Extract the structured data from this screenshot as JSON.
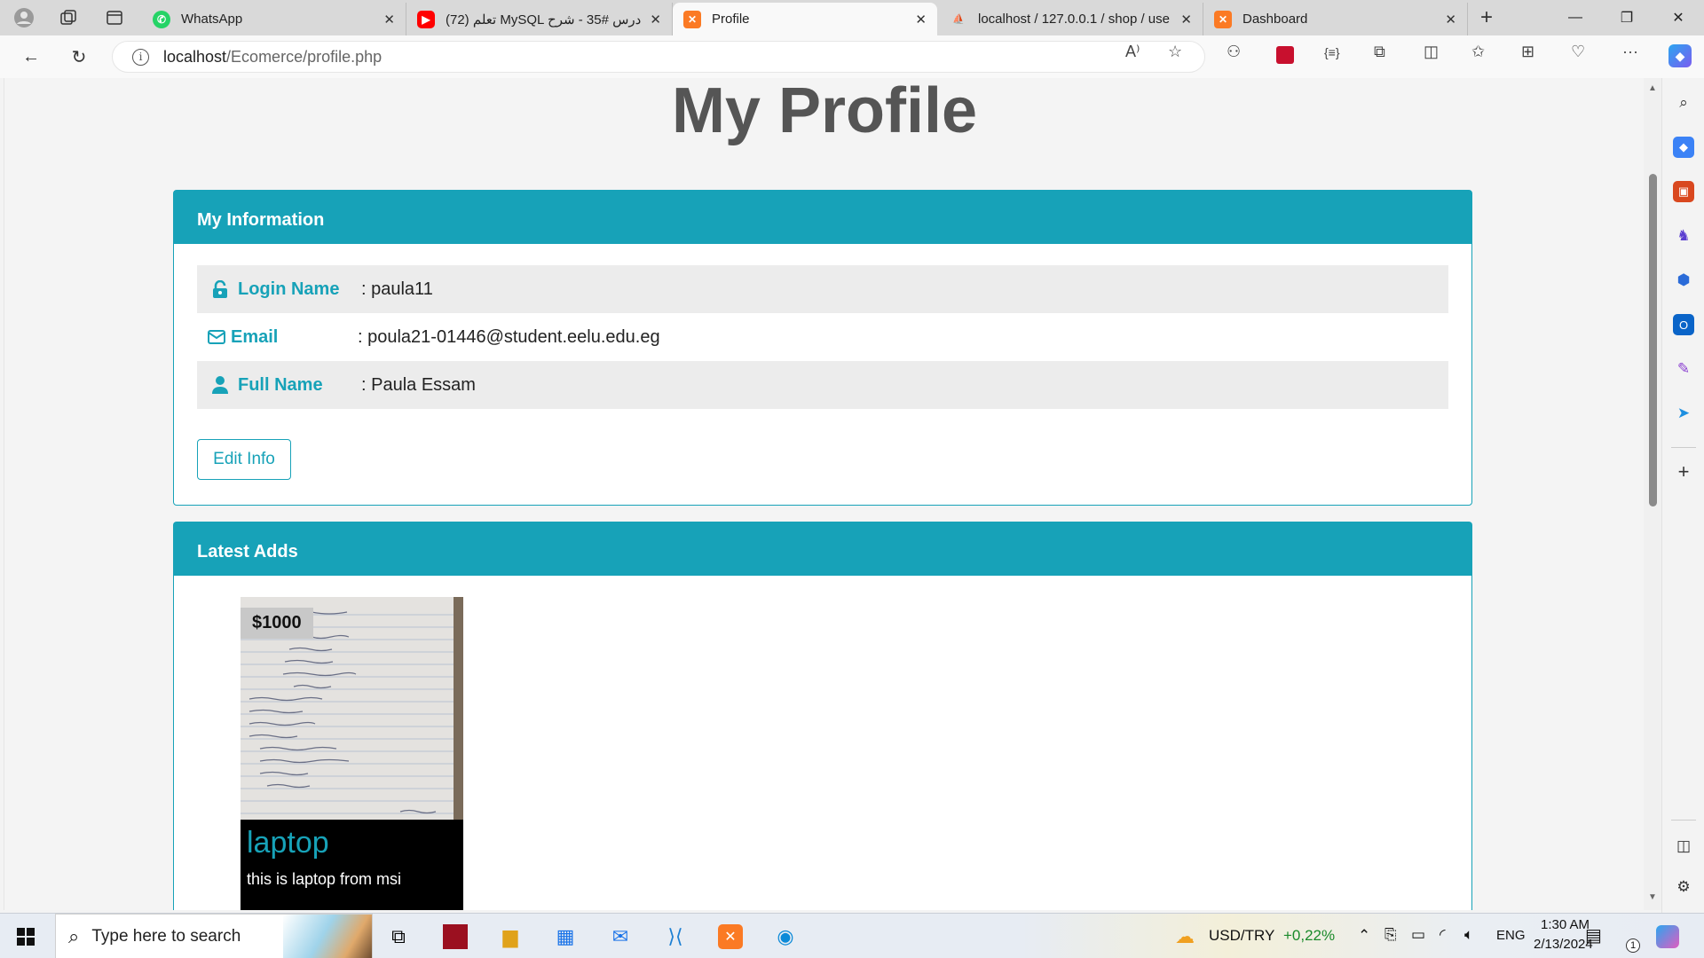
{
  "browser": {
    "tabs": [
      {
        "title": "WhatsApp",
        "favicon": "whatsapp-icon",
        "active": false
      },
      {
        "title": "(72) تعلم MySQL درس #35 - شرح",
        "favicon": "youtube-icon",
        "active": false
      },
      {
        "title": "Profile",
        "favicon": "xampp-icon",
        "active": true
      },
      {
        "title": "localhost / 127.0.0.1 / shop / use",
        "favicon": "phpmyadmin-icon",
        "active": false
      },
      {
        "title": "Dashboard",
        "favicon": "xampp-icon",
        "active": false
      }
    ],
    "address": {
      "host": "localhost",
      "path": "/Ecomerce/profile.php"
    }
  },
  "page": {
    "title": "My Profile",
    "info_panel": {
      "heading": "My Information",
      "rows": [
        {
          "label": "Login Name",
          "value": ": paula11",
          "icon": "unlock-icon"
        },
        {
          "label": "Email",
          "value": ": poula21-01446@student.eelu.edu.eg",
          "icon": "envelope-icon"
        },
        {
          "label": "Full Name",
          "value": ": Paula Essam",
          "icon": "user-icon"
        }
      ],
      "edit_button": "Edit Info"
    },
    "ads_panel": {
      "heading": "Latest Adds",
      "items": [
        {
          "price": "$1000",
          "title": "laptop",
          "description": "this is laptop from msi"
        }
      ]
    }
  },
  "taskbar": {
    "search_placeholder": "Type here to search",
    "currency": {
      "pair": "USD/TRY",
      "change": "+0,22%"
    },
    "language": "ENG",
    "time": "1:30 AM",
    "date": "2/13/2024",
    "notification_count": "1"
  },
  "colors": {
    "accent": "#17a2b8",
    "heading_gray": "#555555"
  }
}
